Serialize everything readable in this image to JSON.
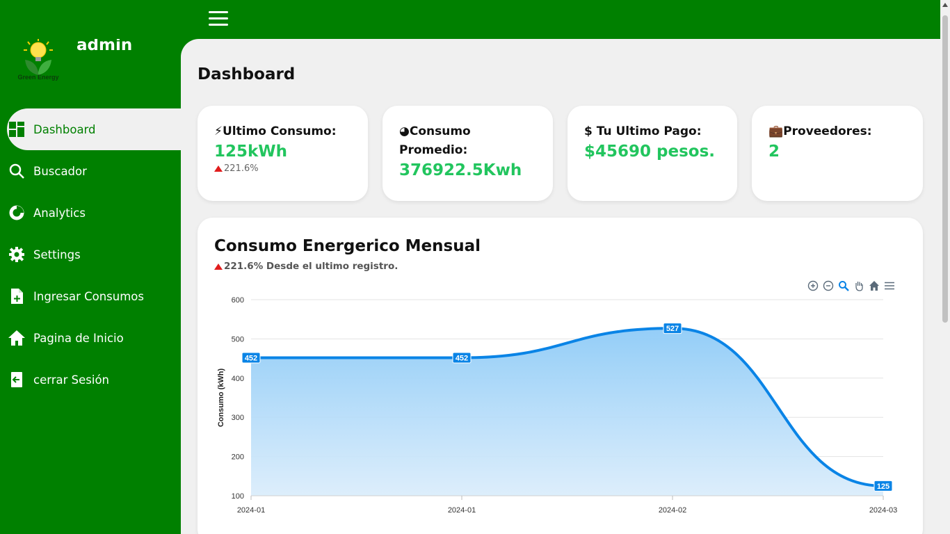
{
  "sidebar": {
    "logo_text": "Green Energy",
    "user_name": "admin",
    "items": [
      {
        "label": "Dashboard",
        "icon": "dashboard-icon",
        "active": true
      },
      {
        "label": "Buscador",
        "icon": "search-icon"
      },
      {
        "label": "Analytics",
        "icon": "pie-chart-icon"
      },
      {
        "label": "Settings",
        "icon": "gear-icon"
      },
      {
        "label": "Ingresar Consumos",
        "icon": "file-add-icon"
      },
      {
        "label": "Pagina de Inicio",
        "icon": "home-icon"
      },
      {
        "label": "cerrar Sesión",
        "icon": "logout-icon"
      }
    ]
  },
  "header": {
    "menu_icon": "hamburger-icon"
  },
  "main": {
    "title": "Dashboard",
    "cards": [
      {
        "label": "Ultimo Consumo:",
        "value": "125kWh",
        "delta": "221.6%",
        "icon": "bolt-icon"
      },
      {
        "label": "Consumo Promedio:",
        "value": "376922.5Kwh",
        "icon": "pie-icon"
      },
      {
        "label": "Tu Ultimo Pago:",
        "value": "$45690 pesos.",
        "icon": "dollar-icon"
      },
      {
        "label": "Proveedores:",
        "value": "2",
        "icon": "briefcase-icon"
      }
    ],
    "chart": {
      "title": "Consumo Energerico Mensual",
      "subtitle": "221.6% Desde el ultimo registro."
    }
  },
  "colors": {
    "brand": "#008000",
    "accent": "#22c55e",
    "series": "#0a84e6",
    "delta": "#e11d1d"
  },
  "chart_data": {
    "type": "area",
    "categories": [
      "2024-01",
      "2024-01",
      "2024-02",
      "2024-03"
    ],
    "series": [
      {
        "values": [
          452,
          452,
          527,
          125
        ]
      }
    ],
    "ylabel": "Consumo (kWh)",
    "ylim": [
      100,
      600
    ],
    "yticks": [
      100,
      200,
      300,
      400,
      500,
      600
    ],
    "grid": true,
    "data_labels": true
  }
}
